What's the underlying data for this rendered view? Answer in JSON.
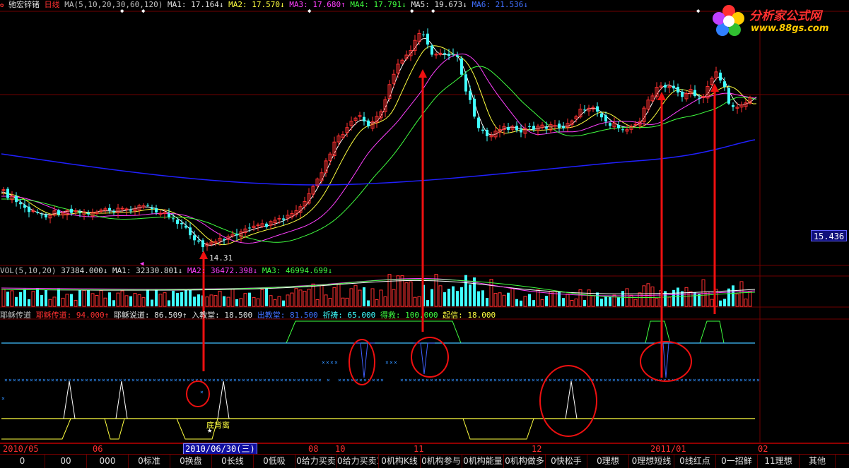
{
  "header_main": {
    "stock_name": "驰宏锌锗",
    "period": "日线",
    "ma_params": "MA(5,10,20,30,60,120)",
    "ma1": "MA1: 17.164↓",
    "ma2": "MA2: 17.570↓",
    "ma3": "MA3: 17.680↑",
    "ma4": "MA4: 17.791↓",
    "ma5": "MA5: 19.673↓",
    "ma6": "MA6: 21.536↓"
  },
  "header_vol": {
    "params": "VOL(5,10,20)",
    "vol": "37384.000↓",
    "ma1": "MA1: 32330.801↓",
    "ma2": "MA2: 36472.398↓",
    "ma3": "MA3: 46994.699↓"
  },
  "header_ind": {
    "name": "耶稣传道",
    "f1": "耶稣传道: 94.000↑",
    "f2": "耶稣说道: 86.509↑",
    "f3": "入教堂: 18.500",
    "f4": "出教堂: 81.500",
    "f5": "祈祷: 65.000",
    "f6": "得救: 100.000",
    "f7": "起信: 18.000"
  },
  "price_badge": "15.436",
  "low_label": "14.31",
  "divergence_label": "底背离",
  "logo": {
    "title": "分析家公式网",
    "url": "www.88gs.com"
  },
  "time_axis": {
    "labels": [
      "2010/05",
      "06",
      "08",
      "10",
      "11",
      "12",
      "2011/01",
      "02"
    ],
    "selected": "2010/06/30(三)"
  },
  "tabs": [
    "0",
    "00",
    "000",
    "0标准",
    "0换盘",
    "0长线",
    "0低吸",
    "0给力买卖",
    "0给力买卖1",
    "0机构K线",
    "0机构参与",
    "0机构能量",
    "0机构做多",
    "0快松手",
    "0理想",
    "0理想短线",
    "0线红点",
    "0一招鲜",
    "11理想",
    "其他"
  ],
  "colors": {
    "up": "#ff3030",
    "down": "#40ffff",
    "ma1": "#ffffff",
    "ma2": "#ffff40",
    "ma3": "#ff40ff",
    "ma4": "#40ff40",
    "ma6": "#2020ff"
  }
}
